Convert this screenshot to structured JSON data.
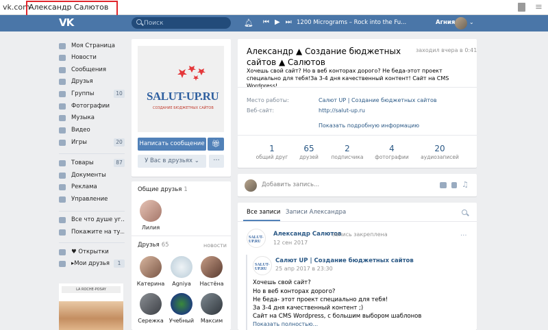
{
  "browser": {
    "domain": "vk.com",
    "tab_title": "Александр Салютов"
  },
  "header": {
    "logo": "VK",
    "search_placeholder": "Поиск",
    "track": "1200 Micrograms – Rock into the Fu...",
    "user_name": "Агния"
  },
  "nav": [
    {
      "label": "Моя Страница",
      "icon": "home-icon"
    },
    {
      "label": "Новости",
      "icon": "news-icon"
    },
    {
      "label": "Сообщения",
      "icon": "message-icon"
    },
    {
      "label": "Друзья",
      "icon": "friend-icon"
    },
    {
      "label": "Группы",
      "icon": "groups-icon",
      "count": "10"
    },
    {
      "label": "Фотографии",
      "icon": "camera-icon"
    },
    {
      "label": "Музыка",
      "icon": "music-icon"
    },
    {
      "label": "Видео",
      "icon": "video-icon"
    },
    {
      "label": "Игры",
      "icon": "games-icon",
      "count": "20"
    },
    {
      "label": "Товары",
      "icon": "goods-icon",
      "count": "87"
    },
    {
      "label": "Документы",
      "icon": "documents-icon"
    },
    {
      "label": "Реклама",
      "icon": "ads-icon"
    },
    {
      "label": "Управление",
      "icon": "gamepad-icon"
    },
    {
      "label": "Все что душе уг...",
      "icon": "app-icon"
    },
    {
      "label": "Покажите на ту...",
      "icon": "app-icon"
    },
    {
      "label": "♥ Открытки",
      "icon": "grid-icon"
    },
    {
      "label": "▸Мои друзья",
      "icon": "grid-icon",
      "count": "1"
    }
  ],
  "ad": {
    "brand": "LA ROCHE-POSAY"
  },
  "profile_card": {
    "logo_text": "SALUT-UP.RU",
    "logo_sub": "СОЗДАНИЕ БЮДЖЕТНЫХ САЙТОВ",
    "message_button": "Написать сообщение",
    "friends_button": "У Вас в друзьях ⌄",
    "more_button": "···"
  },
  "mutual_friends": {
    "title": "Общие друзья",
    "count": "1",
    "items": [
      {
        "name": "Лилия"
      }
    ]
  },
  "friends": {
    "title": "Друзья",
    "count": "65",
    "news_link": "новости",
    "items": [
      {
        "name": "Катерина"
      },
      {
        "name": "Agniya"
      },
      {
        "name": "Настёна"
      },
      {
        "name": "Сережка"
      },
      {
        "name": "Учебный"
      },
      {
        "name": "Максим"
      }
    ]
  },
  "profile": {
    "name": "Александр ▲ Создание бюджетных сайтов ▲ Салютов",
    "last_seen": "заходил вчера в 0:41",
    "status": "Хочешь свой сайт? Но в веб конторах дорого? Не беда-этот проект специально для тебя!За 3-4 дня качественный контент! Сайт на CMS Wordpress!",
    "info": [
      {
        "label": "Место работы:",
        "value": "Салют UP | Создание бюджетных сайтов"
      },
      {
        "label": "Веб-сайт:",
        "value": "http://salut-up.ru"
      }
    ],
    "show_more": "Показать подробную информацию",
    "stats": [
      {
        "num": "1",
        "label": "общий друг"
      },
      {
        "num": "65",
        "label": "друзей"
      },
      {
        "num": "2",
        "label": "подписчика"
      },
      {
        "num": "4",
        "label": "фотографии"
      },
      {
        "num": "20",
        "label": "аудиозаписей"
      }
    ]
  },
  "composer": {
    "placeholder": "Добавить запись..."
  },
  "wall": {
    "tab_all": "Все записи",
    "tab_own": "Записи Александра",
    "post": {
      "author": "Александр Салютов",
      "pinned": "запись закреплена",
      "date": "12 сен 2017",
      "repost_author": "Салют UP | Создание бюджетных сайтов",
      "repost_date": "25 апр 2017 в 23:30",
      "lines": [
        "Хочешь свой сайт?",
        "Но в веб конторах дорого?",
        "Не беда- этот проект специально для тебя!",
        "За 3-4 дня качественный контент ;)",
        "Сайт на CMS Wordpress, с большим выбором шаблонов"
      ],
      "show_full": "Показать полностью..."
    }
  },
  "colors": {
    "header": "#4a76a8",
    "link": "#2a5885",
    "button": "#5181b8",
    "background": "#edeef0"
  }
}
